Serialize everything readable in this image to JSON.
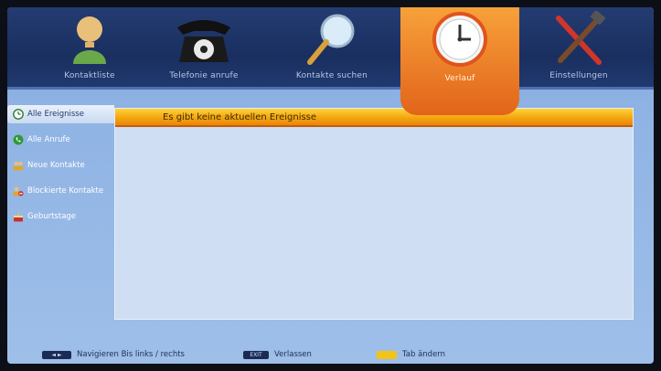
{
  "tabs": [
    {
      "label": "Kontaktliste",
      "icon": "contact-person-icon"
    },
    {
      "label": "Telefonie anrufe",
      "icon": "telephone-icon"
    },
    {
      "label": "Kontakte suchen",
      "icon": "magnifier-icon"
    },
    {
      "label": "Verlauf",
      "icon": "clock-icon",
      "active": true
    },
    {
      "label": "Einstellungen",
      "icon": "tools-icon"
    }
  ],
  "sidebar": {
    "items": [
      {
        "label": "Alle Ereignisse",
        "icon": "clock-icon",
        "active": true
      },
      {
        "label": "Alle Anrufe",
        "icon": "phone-icon"
      },
      {
        "label": "Neue Kontakte",
        "icon": "new-contact-icon"
      },
      {
        "label": "Blockierte Kontakte",
        "icon": "blocked-contact-icon"
      },
      {
        "label": "Geburtstage",
        "icon": "cake-icon"
      }
    ]
  },
  "panel": {
    "message": "Es gibt keine aktuellen Ereignisse"
  },
  "help": {
    "navigate_key": "◄ ►",
    "navigate_label": "Navigieren Bis links / rechts",
    "exit_key": "EXIT",
    "exit_label": "Verlassen",
    "tab_label": "Tab ändern"
  },
  "colors": {
    "accent": "#f08a25",
    "header_bar": "#f4a60f",
    "background": "#8fb3e4",
    "topbar": "#1a2f60"
  }
}
